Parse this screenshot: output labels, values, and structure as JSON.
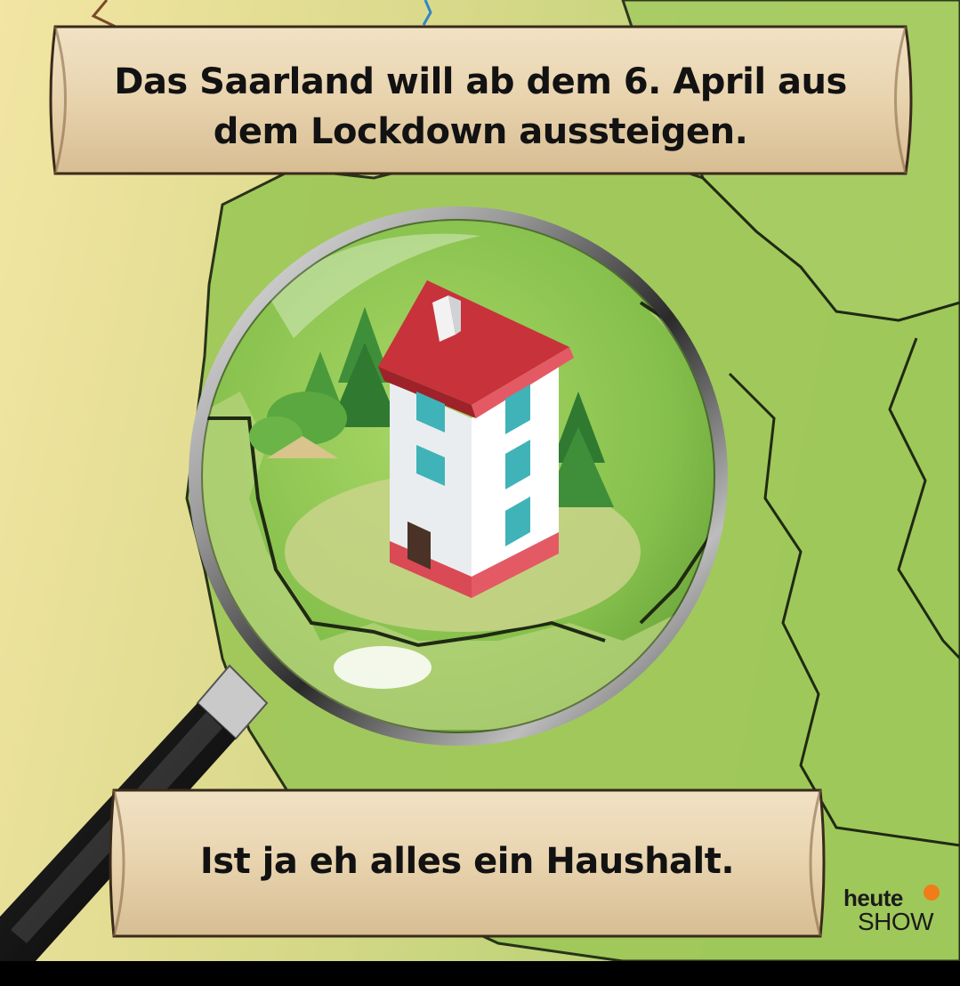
{
  "captions": {
    "top_line1": "Das Saarland will ab dem 6. April aus",
    "top_line2": "dem Lockdown aussteigen.",
    "bottom": "Ist ja eh alles ein Haushalt."
  },
  "logo": {
    "heute": "heute",
    "show": "SHOW"
  },
  "colors": {
    "map_green": "#8fbf4a",
    "map_yellow": "#e8d98a",
    "scroll": "#e8d3b0",
    "roof": "#c8323a",
    "logo_accent": "#f07d19"
  },
  "icons": [
    "magnifying-glass-icon",
    "house-icon",
    "fir-tree-icon"
  ]
}
